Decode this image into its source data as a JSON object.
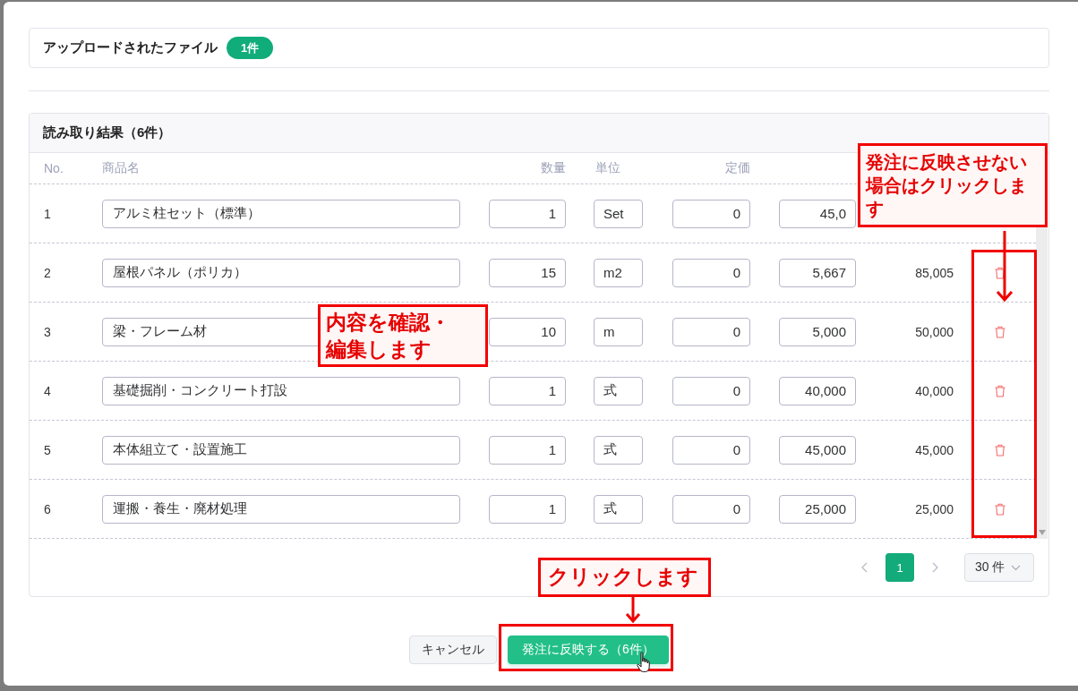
{
  "upload": {
    "title": "アップロードされたファイル",
    "count": "1件"
  },
  "results": {
    "title": "読み取り結果（6件）",
    "columns": [
      "No.",
      "商品名",
      "数量",
      "単位",
      "定価"
    ],
    "rows": [
      {
        "no": "1",
        "name": "アルミ柱セット（標準）",
        "quantity": "1",
        "unit": "Set",
        "list_price": "0",
        "unit_price": "45,0"
      },
      {
        "no": "2",
        "name": "屋根パネル（ポリカ）",
        "quantity": "15",
        "unit": "m2",
        "list_price": "0",
        "unit_price": "5,667",
        "amount": "85,005"
      },
      {
        "no": "3",
        "name": "梁・フレーム材",
        "quantity": "10",
        "unit": "m",
        "list_price": "0",
        "unit_price": "5,000",
        "amount": "50,000"
      },
      {
        "no": "4",
        "name": "基礎掘削・コンクリート打設",
        "quantity": "1",
        "unit": "式",
        "list_price": "0",
        "unit_price": "40,000",
        "amount": "40,000"
      },
      {
        "no": "5",
        "name": "本体組立て・設置施工",
        "quantity": "1",
        "unit": "式",
        "list_price": "0",
        "unit_price": "45,000",
        "amount": "45,000"
      },
      {
        "no": "6",
        "name": "運搬・養生・廃材処理",
        "quantity": "1",
        "unit": "式",
        "list_price": "0",
        "unit_price": "25,000",
        "amount": "25,000"
      }
    ],
    "pagination": {
      "pages": [
        {
          "label": "1",
          "selected": true
        }
      ],
      "page_size": "30 件"
    }
  },
  "footer": {
    "buttons": [
      {
        "label": "キャンセル",
        "kind": "secondary"
      },
      {
        "label": "発注に反映する（6件）",
        "kind": "primary"
      }
    ]
  },
  "annotations": [
    {
      "text": "発注に反映させない場合はクリックします"
    },
    {
      "text": "内容を確認・編集します"
    },
    {
      "text": "クリックします"
    }
  ]
}
